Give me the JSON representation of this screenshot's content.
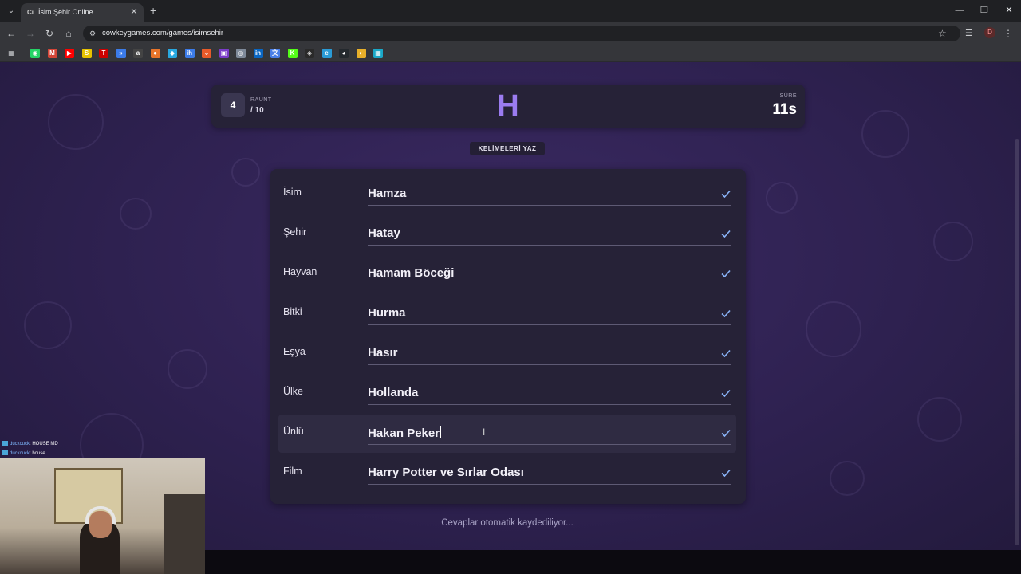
{
  "browser": {
    "tab_title": "İsim Şehir Online",
    "tab_favicon": "Ci",
    "url": "cowkeygames.com/games/isimsehir",
    "profile_initial": "D",
    "new_tab_symbol": "+",
    "close_symbol": "✕",
    "win_minimize": "—",
    "win_maximize": "❐",
    "win_close": "✕",
    "bookmarks": [
      {
        "icon": "whatsapp-icon",
        "glyph": "◉",
        "color": "#25d366"
      },
      {
        "icon": "gmail-icon",
        "glyph": "M",
        "color": "#d44638"
      },
      {
        "icon": "youtube-icon",
        "glyph": "▶",
        "color": "#ff0000"
      },
      {
        "icon": "s-icon",
        "glyph": "S",
        "color": "#e6c200"
      },
      {
        "icon": "tesla-icon",
        "glyph": "T",
        "color": "#cc0000"
      },
      {
        "icon": "arrow-icon",
        "glyph": "»",
        "color": "#3b7be8"
      },
      {
        "icon": "a-icon",
        "glyph": "a",
        "color": "#444444"
      },
      {
        "icon": "circle-icon",
        "glyph": "●",
        "color": "#e8742a"
      },
      {
        "icon": "diamond-icon",
        "glyph": "◆",
        "color": "#29a8e0"
      },
      {
        "icon": "ih-icon",
        "glyph": "ih",
        "color": "#3b7be8"
      },
      {
        "icon": "chevron-icon",
        "glyph": "⌄",
        "color": "#e85a2a"
      },
      {
        "icon": "tv-icon",
        "glyph": "▣",
        "color": "#7a3cc8"
      },
      {
        "icon": "globe-icon",
        "glyph": "◎",
        "color": "#7f8a9a"
      },
      {
        "icon": "linkedin-icon",
        "glyph": "in",
        "color": "#0a66c2"
      },
      {
        "icon": "translate-icon",
        "glyph": "文",
        "color": "#4a7fe8"
      },
      {
        "icon": "kick-icon",
        "glyph": "K",
        "color": "#53fc18"
      },
      {
        "icon": "app-icon",
        "glyph": "◈",
        "color": "#2a2a2a"
      },
      {
        "icon": "edge-icon",
        "glyph": "e",
        "color": "#2a9bd6"
      },
      {
        "icon": "github-icon",
        "glyph": "◕",
        "color": "#24292e"
      },
      {
        "icon": "crypto-icon",
        "glyph": "◐",
        "color": "#e8b02a"
      },
      {
        "icon": "grid-icon",
        "glyph": "▦",
        "color": "#1aa8c8"
      }
    ]
  },
  "game": {
    "round_current": "4",
    "round_label": "RAUNT",
    "round_total": "/ 10",
    "letter": "H",
    "timer_label": "SÜRE",
    "timer_value": "11s",
    "instruction": "KELİMELERİ YAZ",
    "rows": [
      {
        "category": "İsim",
        "answer": "Hamza",
        "valid": true,
        "active": false
      },
      {
        "category": "Şehir",
        "answer": "Hatay",
        "valid": true,
        "active": false
      },
      {
        "category": "Hayvan",
        "answer": "Hamam Böceği",
        "valid": true,
        "active": false
      },
      {
        "category": "Bitki",
        "answer": "Hurma",
        "valid": true,
        "active": false
      },
      {
        "category": "Eşya",
        "answer": "Hasır",
        "valid": true,
        "active": false
      },
      {
        "category": "Ülke",
        "answer": "Hollanda",
        "valid": true,
        "active": false
      },
      {
        "category": "Ünlü",
        "answer": "Hakan Peker",
        "valid": true,
        "active": true
      },
      {
        "category": "Film",
        "answer": "Harry Potter ve Sırlar Odası",
        "valid": true,
        "active": false
      }
    ],
    "autosave_text": "Cevaplar otomatik kaydediliyor...",
    "accent_color": "#9b7cf0",
    "check_color": "#8ab4f8"
  },
  "stream_chat": [
    {
      "user": "duckcuck",
      "message": ": HOUSE MD"
    },
    {
      "user": "duckcuck",
      "message": ": house"
    }
  ]
}
